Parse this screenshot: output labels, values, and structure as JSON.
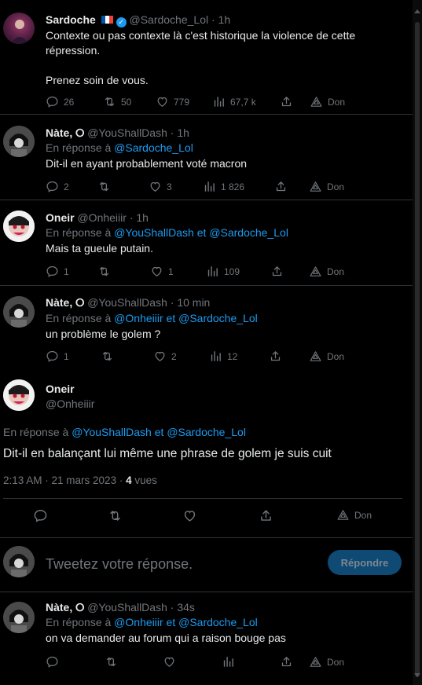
{
  "tweets": [
    {
      "name": "Sardoche",
      "handle": "@Sardoche_Lol",
      "time": "· 1h",
      "text_lines": [
        "Contexte ou pas contexte là c'est historique la violence de cette",
        "répression.",
        "",
        "Prenez soin de vous."
      ],
      "replies": "26",
      "retweets": "50",
      "likes": "779",
      "views": "67,7 k",
      "don": "Don"
    },
    {
      "name": "Nàte, ⭘",
      "handle": "@YouShallDash",
      "time": "· 1h",
      "reply_prefix": "En réponse à",
      "reply_to": [
        "@Sardoche_Lol"
      ],
      "text": "Dit-il en ayant probablement voté macron",
      "replies": "2",
      "retweets": "",
      "likes": "3",
      "views": "1 826",
      "don": "Don"
    },
    {
      "name": "Oneir",
      "handle": "@Onheiiir",
      "time": "· 1h",
      "reply_prefix": "En réponse à",
      "reply_to": [
        "@YouShallDash",
        "@Sardoche_Lol"
      ],
      "connector": "et",
      "text": "Mais ta gueule putain.",
      "replies": "1",
      "retweets": "",
      "likes": "1",
      "views": "109",
      "don": "Don"
    },
    {
      "name": "Nàte, ⭘",
      "handle": "@YouShallDash",
      "time": "· 10 min",
      "reply_prefix": "En réponse à",
      "reply_to": [
        "@Onheiiir",
        "@Sardoche_Lol"
      ],
      "connector": "et",
      "text": "un problème le golem ?",
      "replies": "1",
      "retweets": "",
      "likes": "2",
      "views": "12",
      "don": "Don"
    }
  ],
  "main": {
    "name": "Oneir",
    "handle": "@Onheiiir",
    "reply_prefix": "En réponse à",
    "reply_to": [
      "@YouShallDash",
      "@Sardoche_Lol"
    ],
    "connector": "et",
    "text": "Dit-il en balançant lui même une phrase de golem je suis cuit",
    "timestamp": "2:13 AM · 21 mars 2023 ·",
    "views_count": "4",
    "views_label": "vues",
    "don": "Don"
  },
  "reply_box": {
    "placeholder": "Tweetez votre réponse.",
    "button": "Répondre"
  },
  "last_tweet": {
    "name": "Nàte, ⭘",
    "handle": "@YouShallDash",
    "time": "· 34s",
    "reply_prefix": "En réponse à",
    "reply_to": [
      "@Onheiiir",
      "@Sardoche_Lol"
    ],
    "connector": "et",
    "text": "on va demander au forum qui a raison bouge pas",
    "don": "Don"
  },
  "colors": {
    "accent": "#1d9bf0",
    "muted": "#71767b",
    "text": "#e7e9ea",
    "background": "#000000"
  },
  "icons": [
    "reply-icon",
    "retweet-icon",
    "like-icon",
    "views-icon",
    "share-icon",
    "tip-icon",
    "verified-badge-icon",
    "france-flag-icon"
  ]
}
